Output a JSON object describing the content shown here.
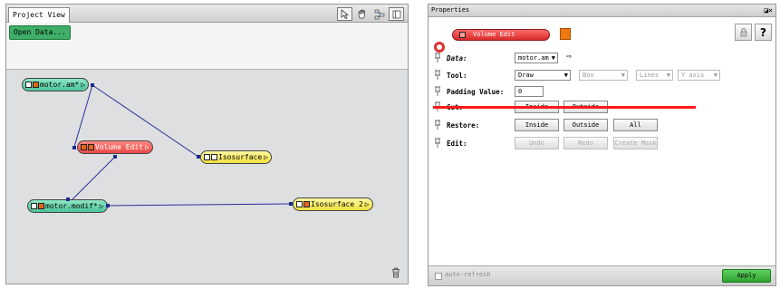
{
  "project_view": {
    "tab_label": "Project View",
    "open_data_label": "Open Data...",
    "nodes": {
      "motor_am": "motor.am*",
      "volume_edit": "Volume Edit",
      "isosurface_1": "Isosurface",
      "motor_modif": "motor.modif*",
      "isosurface_2": "Isosurface 2"
    }
  },
  "properties": {
    "title": "Properties",
    "module_name": "Volume Edit",
    "colors": {
      "module": "#d72a2a",
      "accent_square": "#f07a10",
      "apply": "#2fa22f"
    },
    "data": {
      "label": "Data:",
      "value": "motor.am"
    },
    "tool": {
      "label": "Tool:",
      "value": "Draw",
      "shape": "Box",
      "mode": "Lines",
      "axis": "Y axis"
    },
    "padding": {
      "label": "Padding Value:",
      "value": "0"
    },
    "cut": {
      "label": "Cut:",
      "buttons": [
        "Inside",
        "Outside"
      ]
    },
    "restore": {
      "label": "Restore:",
      "buttons": [
        "Inside",
        "Outside",
        "All"
      ]
    },
    "edit": {
      "label": "Edit:",
      "buttons": [
        "Undo",
        "Redo",
        "Create Mask"
      ]
    },
    "auto_refresh_label": "auto-refresh",
    "apply_label": "Apply"
  }
}
